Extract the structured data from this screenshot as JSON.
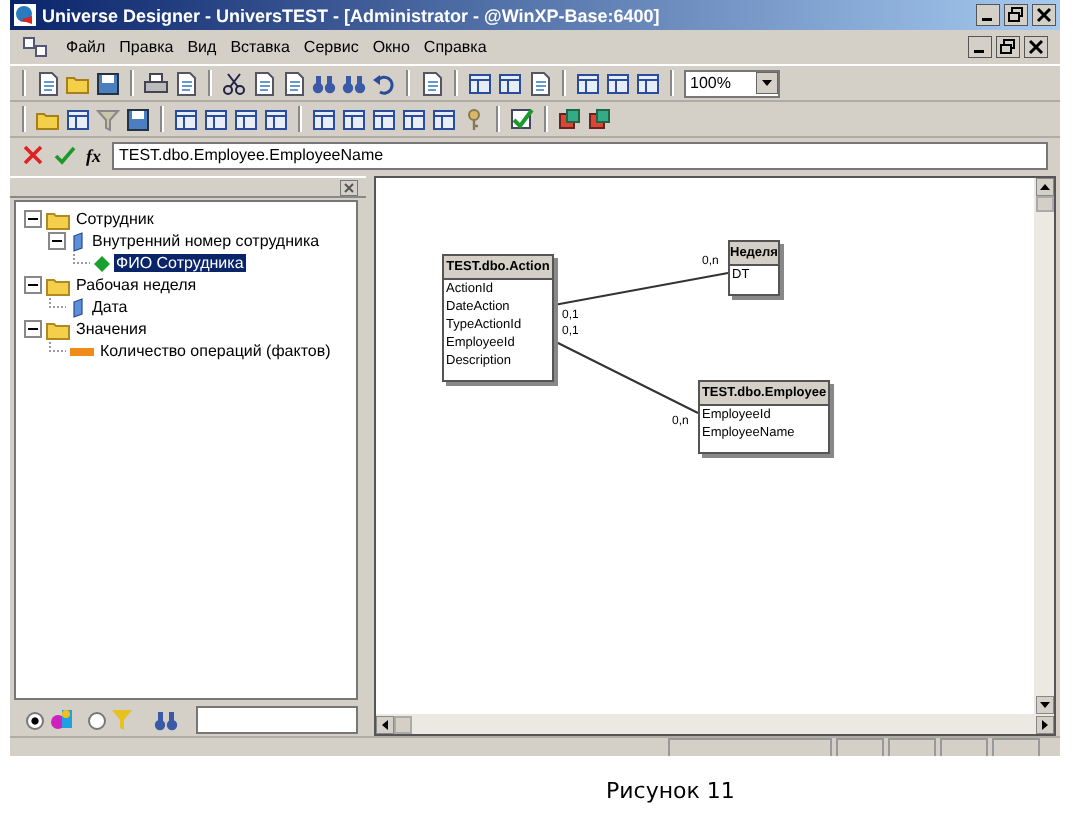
{
  "window": {
    "title": "Universe Designer - UniversTEST - [Administrator - @WinXP-Base:6400]"
  },
  "menu": [
    "Файл",
    "Правка",
    "Вид",
    "Вставка",
    "Сервис",
    "Окно",
    "Справка"
  ],
  "zoom": {
    "value": "100%"
  },
  "formula_bar": {
    "function_label": "fx",
    "value": "TEST.dbo.Employee.EmployeeName"
  },
  "tree": [
    {
      "label": "Сотрудник",
      "kind": "class",
      "expanded": true,
      "selected": false,
      "children": [
        {
          "label": "Внутренний номер сотрудника",
          "kind": "dimension",
          "expanded": true,
          "selected": false,
          "children": [
            {
              "label": "ФИО Сотрудника",
              "kind": "detail",
              "selected": true
            }
          ]
        }
      ]
    },
    {
      "label": "Рабочая неделя",
      "kind": "class",
      "expanded": true,
      "selected": false,
      "children": [
        {
          "label": "Дата",
          "kind": "dimension",
          "selected": false
        }
      ]
    },
    {
      "label": "Значения",
      "kind": "class",
      "expanded": true,
      "selected": false,
      "children": [
        {
          "label": "Количество операций (фактов)",
          "kind": "measure",
          "selected": false
        }
      ]
    }
  ],
  "view_mode": [
    {
      "kind": "classes",
      "selected": true
    },
    {
      "kind": "filters",
      "selected": false
    }
  ],
  "diagram": {
    "tables": [
      {
        "name": "TEST.dbo.Action",
        "columns": [
          "ActionId",
          "DateAction",
          "TypeActionId",
          "EmployeeId",
          "Description"
        ]
      },
      {
        "name": "Неделя",
        "columns": [
          "DT"
        ]
      },
      {
        "name": "TEST.dbo.Employee",
        "columns": [
          "EmployeeId",
          "EmployeeName"
        ]
      }
    ],
    "joins": [
      {
        "from_card": "0,1",
        "to_card": "0,n"
      },
      {
        "from_card": "0,1",
        "to_card": "0,n"
      }
    ]
  },
  "caption": "Рисунок 11"
}
